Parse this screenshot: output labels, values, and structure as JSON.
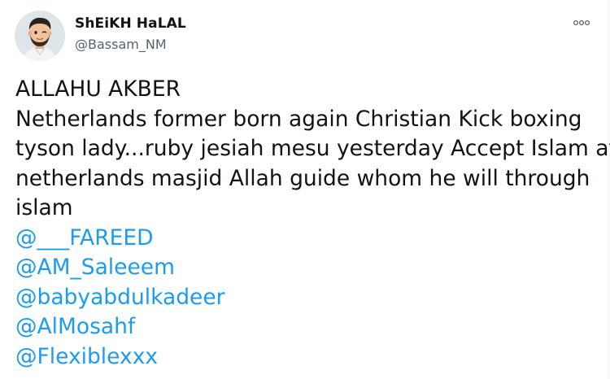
{
  "author": {
    "display_name": "ShEiKH HaLAL",
    "handle": "@Bassam_NM"
  },
  "icons": {
    "more": "more-options-icon",
    "avatar": "memoji-avatar"
  },
  "colors": {
    "text": "#0f1419",
    "secondary": "#536471",
    "link": "#1d9bf0",
    "background": "#ffffff"
  },
  "tweet": {
    "lines": [
      "ALLAHU AKBER",
      "Netherlands former born again Christian Kick boxing",
      "tyson lady...ruby jesiah mesu yesterday Accept Islam at",
      "netherlands masjid Allah guide whom he will through",
      "islam"
    ],
    "mentions": [
      "@___FAREED",
      "@AM_Saleeem",
      "@babyabdulkadeer",
      "@AlMosahf",
      "@Flexiblexxx"
    ]
  }
}
